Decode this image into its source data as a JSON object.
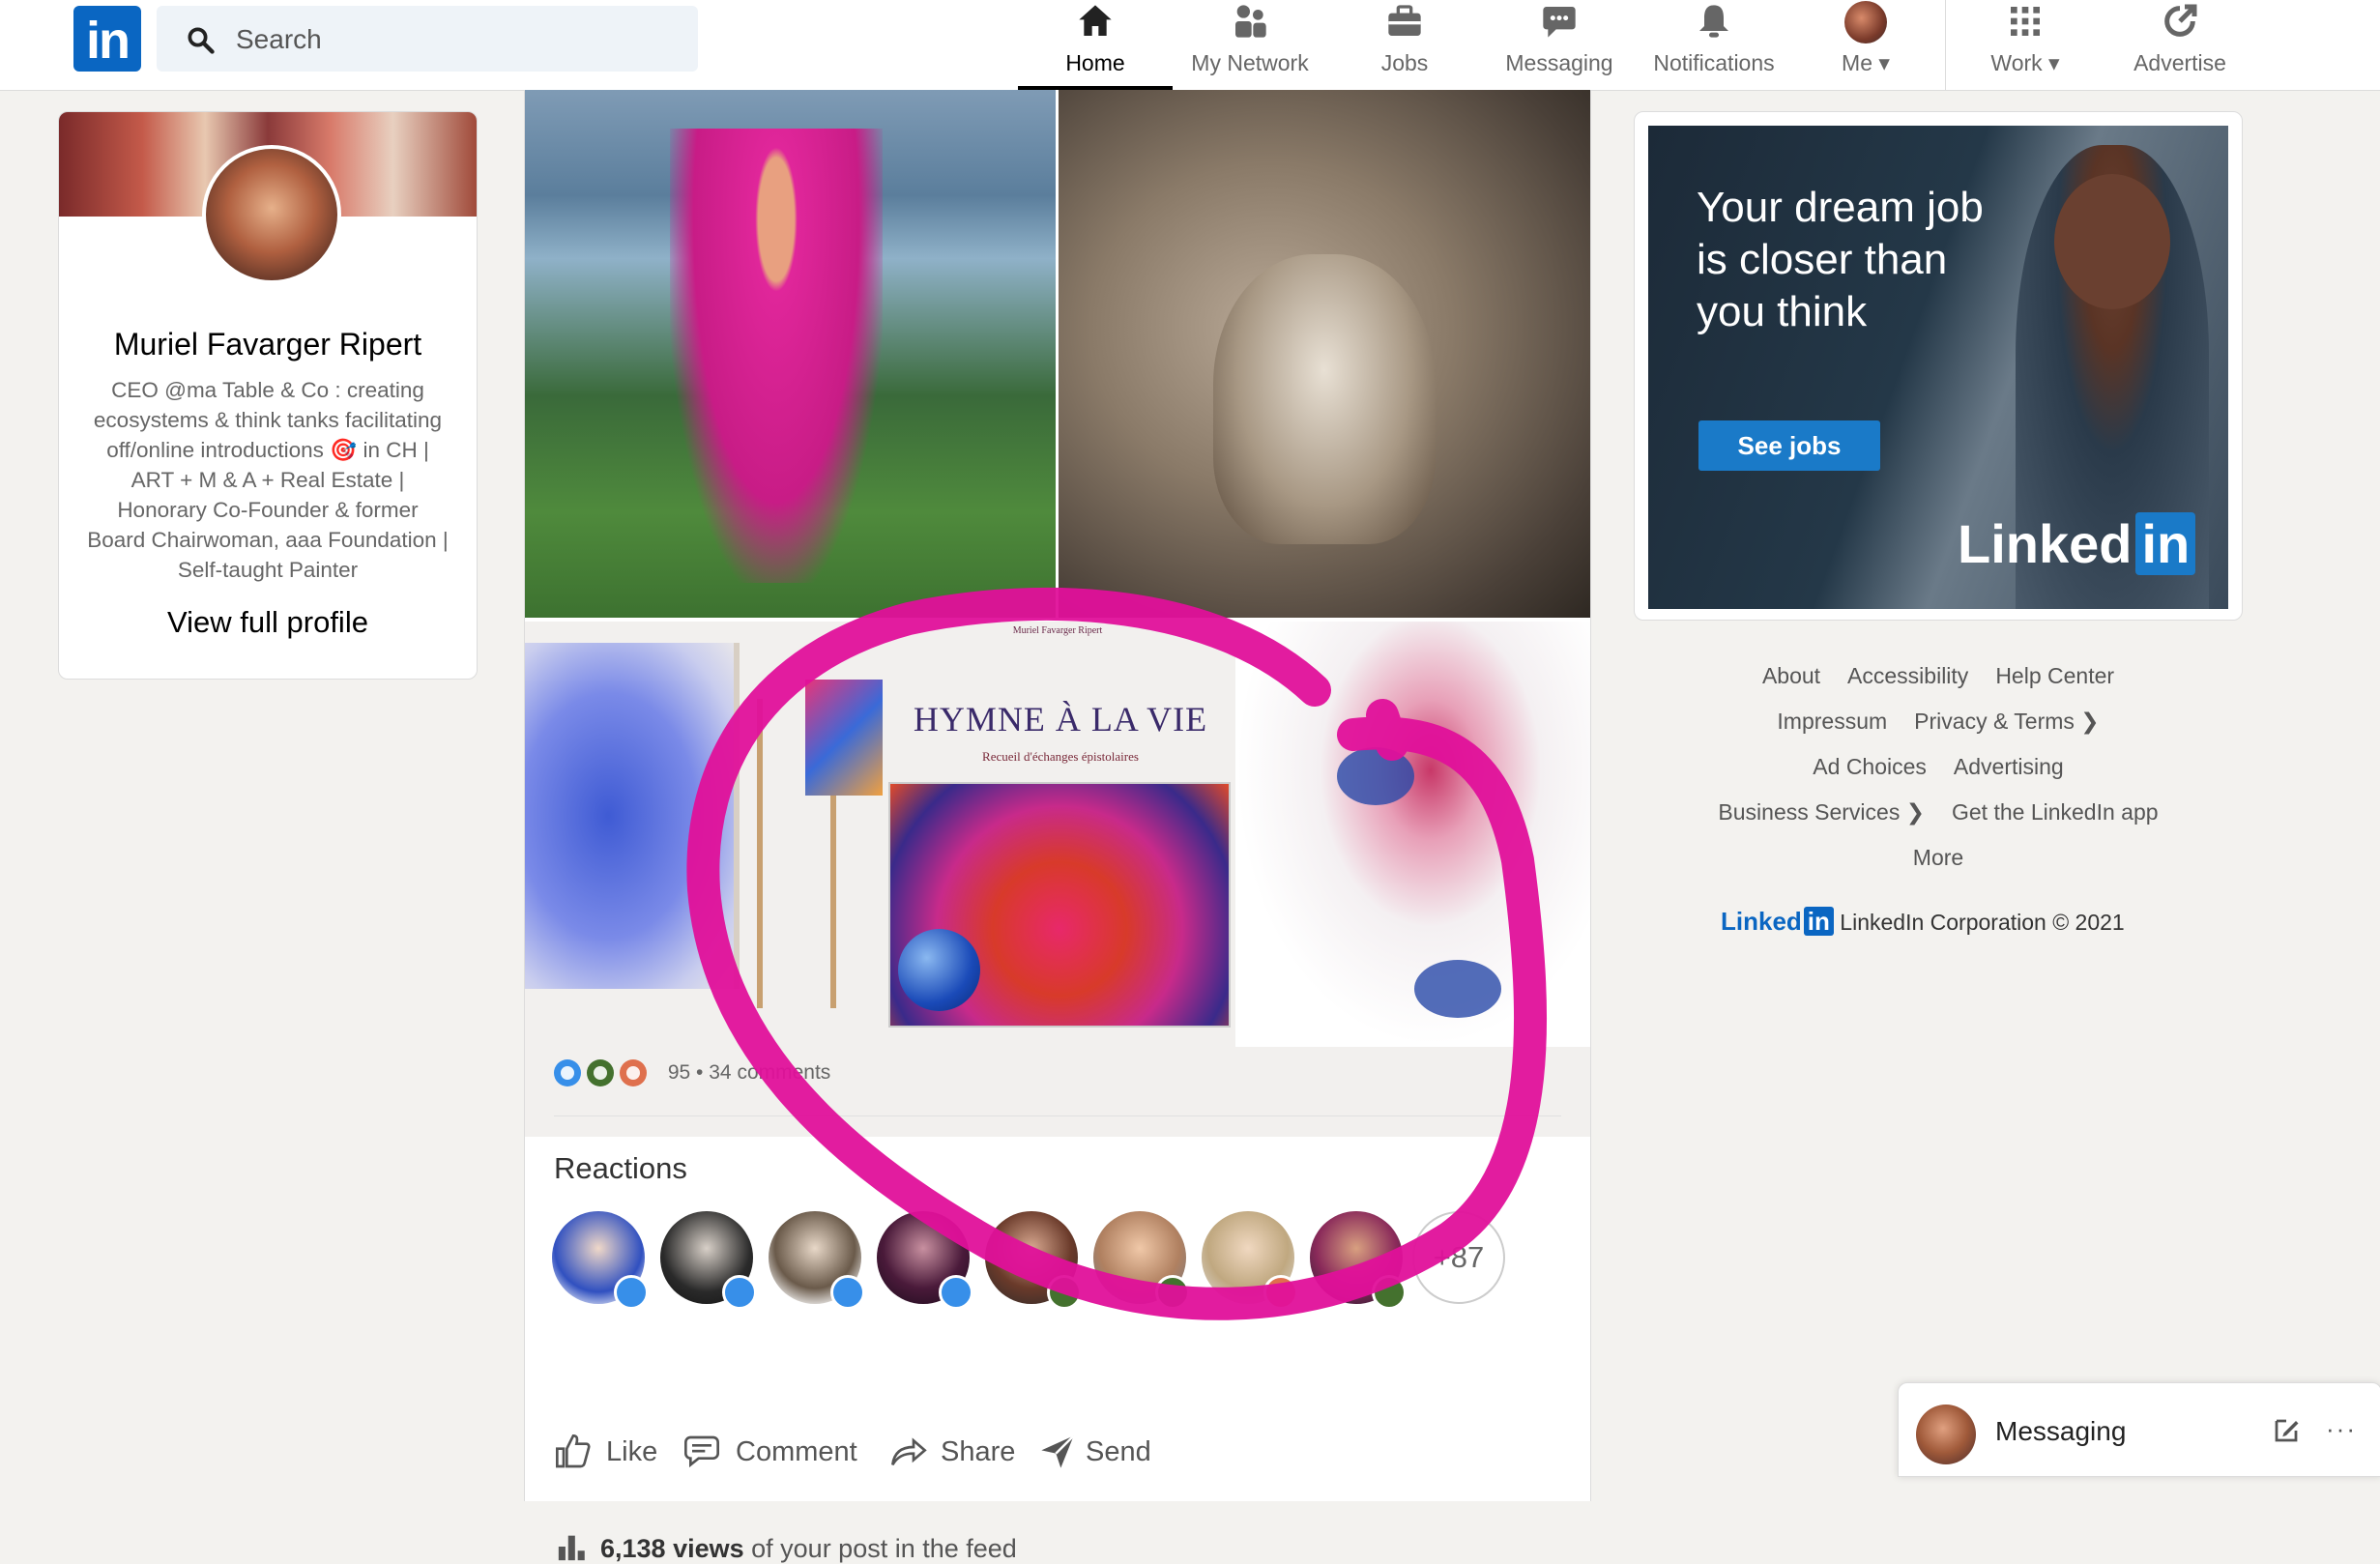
{
  "nav": {
    "logo_text": "in",
    "search_placeholder": "Search",
    "items": [
      {
        "label": "Home",
        "icon": "home-icon",
        "active": true
      },
      {
        "label": "My Network",
        "icon": "network-icon"
      },
      {
        "label": "Jobs",
        "icon": "briefcase-icon"
      },
      {
        "label": "Messaging",
        "icon": "chat-icon"
      },
      {
        "label": "Notifications",
        "icon": "bell-icon"
      },
      {
        "label": "Me",
        "icon": "avatar"
      },
      {
        "label": "Work",
        "icon": "grid-icon"
      },
      {
        "label": "Advertise",
        "icon": "advertise-icon"
      }
    ]
  },
  "profile": {
    "name": "Muriel Favarger Ripert",
    "headline": "CEO @ma Table & Co : creating ecosystems & think tanks facilitating off/online introductions 🎯 in CH | ART + M & A + Real Estate | Honorary Co-Founder & former Board Chairwoman, aaa Foundation | Self-taught Painter",
    "view_profile": "View full profile"
  },
  "post": {
    "book_credit": "Muriel Favarger Ripert",
    "book_title": "HYMNE À LA VIE",
    "book_subtitle": "Recueil d'échanges épistolaires",
    "reaction_count": "95",
    "separator": "•",
    "comments": "34 comments",
    "reactions_title": "Reactions",
    "more_reactors": "+87",
    "actions": {
      "like": "Like",
      "comment": "Comment",
      "share": "Share",
      "send": "Send"
    },
    "views_count": "6,138 views",
    "views_suffix": "of your post in the feed"
  },
  "ad": {
    "headline": "Your dream job is closer than you think",
    "button": "See jobs",
    "brand": "Linked",
    "brand_in": "in"
  },
  "footer": {
    "links": [
      "About",
      "Accessibility",
      "Help Center",
      "Impressum",
      "Privacy & Terms ❯",
      "Ad Choices",
      "Advertising",
      "Business Services ❯",
      "Get the LinkedIn app",
      "More"
    ],
    "brand": "Linked",
    "brand_in": "in",
    "copyright": "LinkedIn Corporation © 2021"
  },
  "messaging": {
    "title": "Messaging",
    "more": "···"
  },
  "colors": {
    "brand_blue": "#0a66c2",
    "annotation_pink": "#e0109a",
    "like": "#378fe9",
    "celebrate": "#44712e",
    "love": "#df704d"
  }
}
